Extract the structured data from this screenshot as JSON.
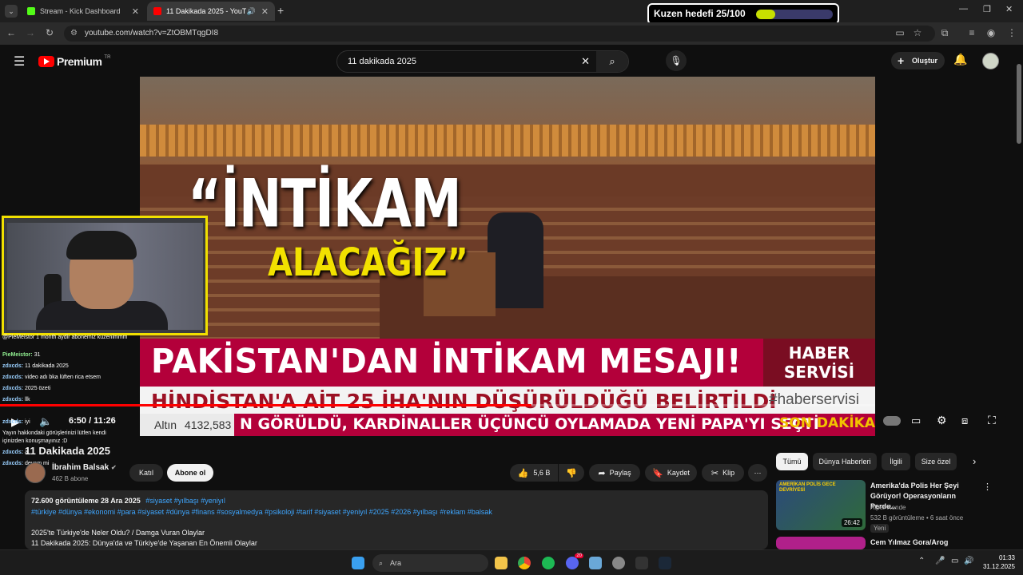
{
  "browser": {
    "tabs": [
      {
        "label": "Stream - Kick Dashboard"
      },
      {
        "label": "11 Dakikada 2025 - YouTube"
      }
    ],
    "url": "youtube.com/watch?v=ZtOBMTqgDI8"
  },
  "goal_widget": {
    "label": "Kuzen hedefi 25/100",
    "progress": 0.25
  },
  "youtube": {
    "logo_text": "Premium",
    "region": "TR",
    "search_value": "11 dakikada 2025",
    "create_label": "Oluştur"
  },
  "video": {
    "overlay_quote": "“İNTİKAM",
    "overlay_sub": "ALACAĞIZ”",
    "headline": "PAKİSTAN'DAN İNTİKAM MESAJI!",
    "badge_line1": "HABER",
    "badge_line2": "SERVİSİ",
    "subheadline": "HİNDİSTAN'A AİT 25 İHA'NIN DÜŞÜRÜLDÜĞÜ BELİRTİLDİ",
    "hashtag": "#haberservisi",
    "ticker_label": "Altın",
    "ticker_value": "4132,583",
    "ticker_text": "N GÖRÜLDÜ, KARDİNALLER ÜÇÜNCÜ OYLAMADA YENİ PAPA'YI SEÇTİ",
    "ticker_end": "SON DAKİKA",
    "time": "6:50 / 11:26",
    "progress": 0.607
  },
  "chat": [
    {
      "user": "",
      "msg": "@PieMeistor 1 month aydir abonemiz kuzenimmm"
    },
    {
      "user": "PieMeistor:",
      "msg": "31"
    },
    {
      "user": "zdxcds:",
      "msg": "11 dakikada 2025"
    },
    {
      "user": "zdxcds:",
      "msg": "video adı bka lüften rica etsem"
    },
    {
      "user": "zdxcds:",
      "msg": "2025 özeti"
    },
    {
      "user": "zdxcds:",
      "msg": "llk"
    },
    {
      "user": "zdxcds:",
      "msg": "iyi"
    },
    {
      "user": "",
      "msg": "Yayın hakkındaki görüşlerinizi lütfen kendi"
    },
    {
      "user": "",
      "msg": "içinizden konuşmayınız :D"
    },
    {
      "user": "zdxcds:",
      "msg": "a"
    },
    {
      "user": "zdxcds:",
      "msg": "devam mi"
    }
  ],
  "meta": {
    "title": "11 Dakikada 2025",
    "channel": "İbrahim Balsak",
    "subscribers": "462 B abone",
    "join_label": "Katıl",
    "subscribe_label": "Abone ol",
    "likes": "5,6 B",
    "share_label": "Paylaş",
    "save_label": "Kaydet",
    "clip_label": "Klip"
  },
  "description": {
    "stats": "72.600 görüntüleme  28 Ara 2025",
    "top_tags": "#siyaset #yılbaşı #yeniyıl",
    "tags": "#türkiye #dünya #ekonomi #para #siyaset #dünya #finans #sosyalmedya #psikoloji #tarif #siyaset #yeniyıl #2025 #2026 #yılbaşı #reklam #balsak",
    "line1": "2025'te Türkiye'de Neler Oldu? / Damga Vuran Olaylar",
    "line2": "11 Dakikada 2025: Dünya'da ve Türkiye'de Yaşanan En Önemli Olaylar"
  },
  "sidebar": {
    "chips": [
      "Tümü",
      "Dünya Haberleri",
      "İlgili",
      "Size özel"
    ],
    "recs": [
      {
        "title": "Amerika'da Polis Her Şeyi Görüyor! Operasyonların Perde...",
        "channel": "Alper Rende",
        "meta": "532 B görüntüleme • 6 saat önce",
        "badge": "Yeni",
        "duration": "26:42",
        "thumb_text": "AMERİKAN POLİS GECE DEVRİYESİ"
      },
      {
        "title": "Cem Yılmaz Gora/Arog",
        "channel": "",
        "meta": "",
        "badge": "",
        "duration": "",
        "thumb_text": ""
      }
    ]
  },
  "taskbar": {
    "search_placeholder": "Ara",
    "time": "01:33",
    "date": "31.12.2025",
    "discord_badge": "20"
  }
}
